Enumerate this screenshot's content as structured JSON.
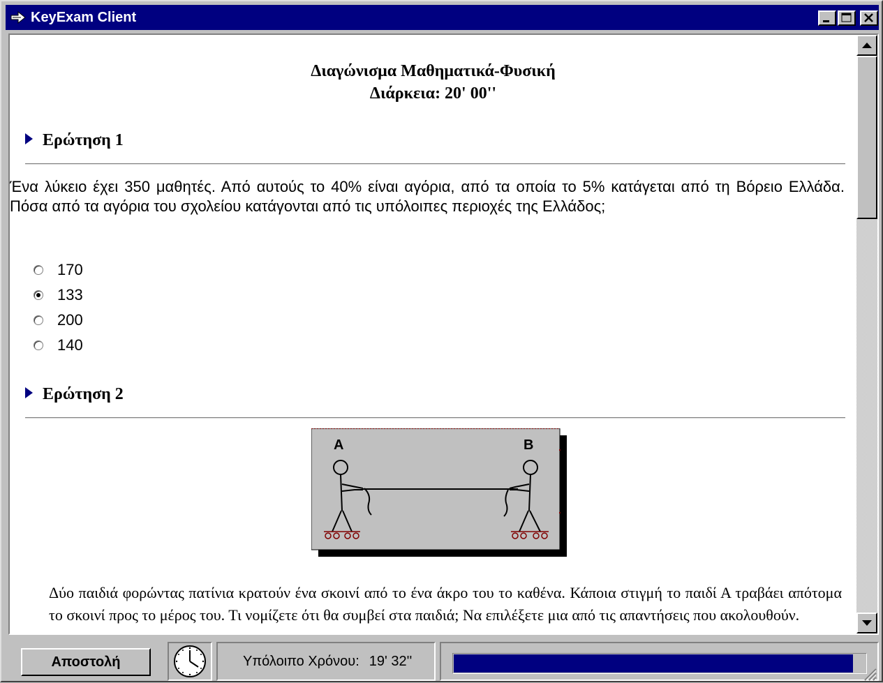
{
  "window": {
    "title": "KeyExam Client"
  },
  "exam": {
    "title": "Διαγώνισμα Μαθηματικά-Φυσική",
    "duration": "Διάρκεια: 20' 00''"
  },
  "question1": {
    "heading": "Ερώτηση 1",
    "text": "Ένα λύκειο έχει 350 μαθητές. Από αυτούς το 40% είναι αγόρια, από τα οποία το 5% κατάγεται από τη Βόρειο Ελλάδα. Πόσα από τα αγόρια του σχολείου κατάγονται από τις υπόλοιπες περιοχές της Ελλάδος;",
    "options": [
      {
        "label": "170",
        "selected": false
      },
      {
        "label": "133",
        "selected": true
      },
      {
        "label": "200",
        "selected": false
      },
      {
        "label": "140",
        "selected": false
      }
    ]
  },
  "question2": {
    "heading": "Ερώτηση 2",
    "figure": {
      "label_a": "A",
      "label_b": "B"
    },
    "text": "Δύο παιδιά φορώντας πατίνια κρατούν ένα σκοινί από το ένα άκρο του το καθένα. Κάποια στιγμή το παιδί Α τραβάει απότομα το σκοινί προς το μέρος του. Τι νομίζετε ότι θα συμβεί στα παιδιά; Να επιλέξετε μια από τις απαντήσεις που ακολουθούν."
  },
  "status": {
    "send_label": "Αποστολή",
    "time_label": "Υπόλοιπο Χρόνου:",
    "time_value": "19' 32''",
    "progress": 0.97
  },
  "icons": {
    "title": "arrow-app-icon",
    "clock": "clock-icon"
  },
  "colors": {
    "titlebar": "#000080",
    "progress": "#000080",
    "face": "#c0c0c0"
  }
}
